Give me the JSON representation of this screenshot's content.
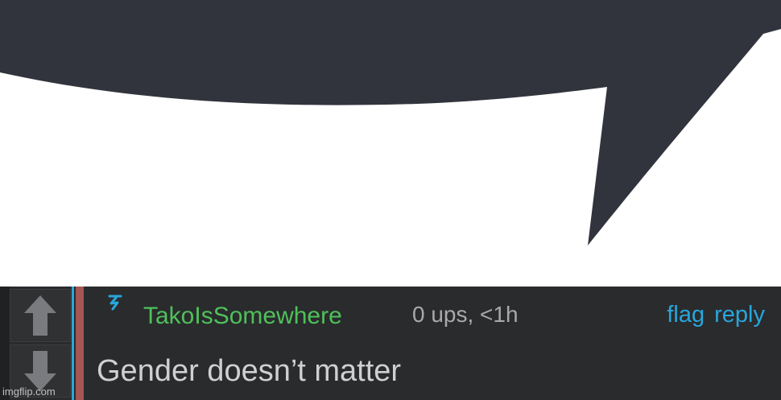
{
  "comment": {
    "username": "TakoIsSomewhere",
    "stats": "0 ups, <1h",
    "text": "Gender doesn’t matter",
    "actions": {
      "flag": "flag",
      "reply": "reply"
    }
  },
  "watermark": "imgflip.com",
  "icons": {
    "upvote": "upvote-arrow-icon",
    "downvote": "downvote-arrow-icon",
    "mod": "mod-badge-icon"
  },
  "colors": {
    "bubble": "#32343d",
    "bar_bg": "#2a2b2d",
    "username": "#4fc05a",
    "link": "#28a6dc",
    "accent_blue": "#2aa7d6",
    "accent_red": "#a65656"
  }
}
